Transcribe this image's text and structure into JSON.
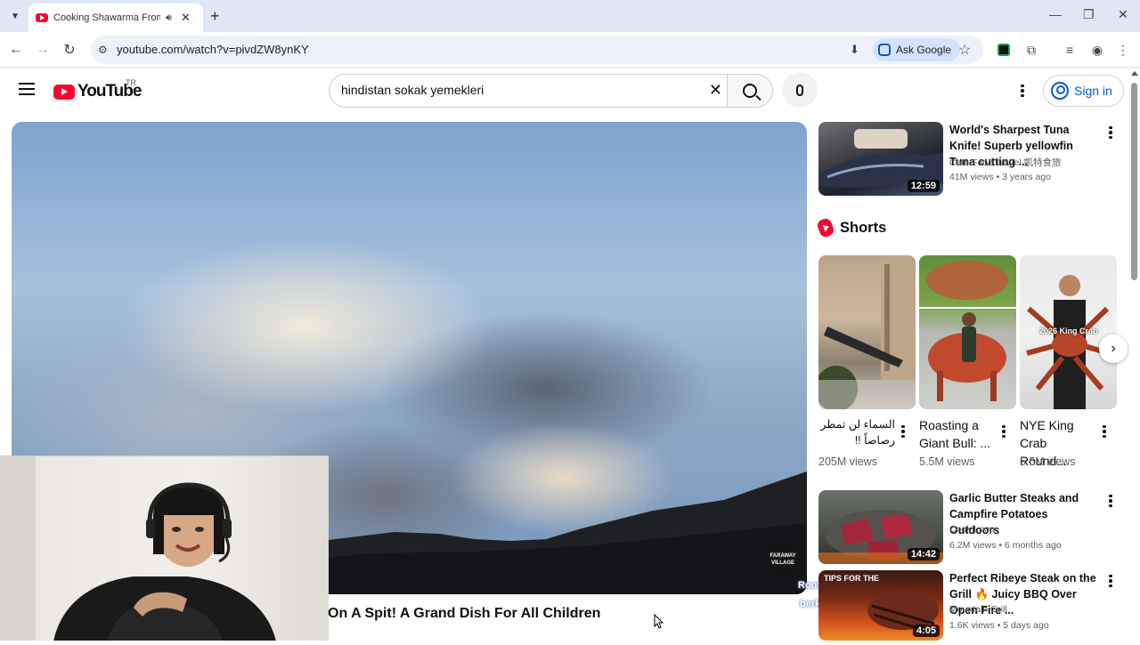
{
  "browser": {
    "tab_title": "Cooking Shawarma From A",
    "url": "youtube.com/watch?v=pivdZW8ynKY",
    "ask_google": "Ask Google"
  },
  "header": {
    "logo_text": "YouTube",
    "country": "TR",
    "search_value": "hindistan sokak yemekleri",
    "sign_in": "Sign in"
  },
  "video": {
    "title": "On A Spit! A Grand Dish For All Children",
    "watermark": "FARAWAY VILLAGE"
  },
  "overlay": {
    "line1": "Rootsevent Odak",
    "line2": "berkayedizonE"
  },
  "sidebar": {
    "videos": [
      {
        "title": "World's Sharpest Tuna Knife! Superb yellowfin Tuna cutting ...",
        "channel": "Cate Food Travel 凱特食旅",
        "meta": "41M views • 3 years ago",
        "duration": "12:59"
      },
      {
        "title": "Garlic Butter Steaks and Campfire Potatoes Outdoors",
        "channel": "Cook Loop",
        "meta": "6.2M views • 6 months ago",
        "duration": "14:42"
      },
      {
        "title": "Perfect Ribeye Steak on the Grill 🔥 Juicy BBQ Over Open Fire ...",
        "channel": "Mountain Grill",
        "meta": "1.6K views • 5 days ago",
        "duration": "4:05",
        "thumb_text": "TIPS FOR THE"
      }
    ],
    "shorts_heading": "Shorts",
    "shorts": [
      {
        "title": "السماء لن تمطر رصاصاً !!",
        "views": "205M views"
      },
      {
        "title": "Roasting a Giant Bull: ...",
        "views": "5.5M views"
      },
      {
        "title": "NYE King Crab Round...",
        "views": "5.5M views",
        "thumb_text": "2026 King Crab"
      }
    ]
  },
  "colors": {
    "brand_red": "#ff0033",
    "link_blue": "#065fd4",
    "tab_strip": "#dfe7f7"
  },
  "icons": [
    "tab-search-icon",
    "youtube-favicon",
    "audio-icon",
    "close-icon",
    "plus-icon",
    "minimize-icon",
    "restore-icon",
    "back-icon",
    "forward-icon",
    "reload-icon",
    "site-info-icon",
    "install-icon",
    "star-icon",
    "extension-icon",
    "puzzle-icon",
    "media-icon",
    "profile-icon",
    "menu-icon",
    "search-icon",
    "mic-icon",
    "more-icon",
    "account-icon",
    "shorts-icon",
    "chevron-right-icon"
  ]
}
